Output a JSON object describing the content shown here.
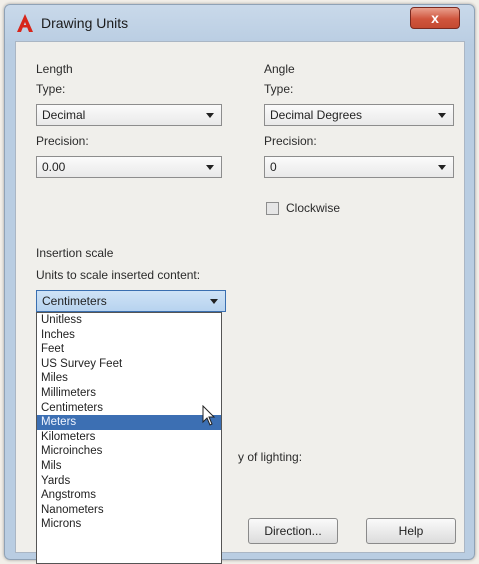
{
  "window": {
    "title": "Drawing Units",
    "close_label": "x"
  },
  "length": {
    "group_label": "Length",
    "type_label": "Type:",
    "type_value": "Decimal",
    "precision_label": "Precision:",
    "precision_value": "0.00"
  },
  "angle": {
    "group_label": "Angle",
    "type_label": "Type:",
    "type_value": "Decimal Degrees",
    "precision_label": "Precision:",
    "precision_value": "0",
    "clockwise_label": "Clockwise"
  },
  "insertion": {
    "group_label": "Insertion scale",
    "units_label": "Units to scale inserted content:",
    "selected_value": "Centimeters",
    "options": [
      "Unitless",
      "Inches",
      "Feet",
      "US Survey Feet",
      "Miles",
      "Millimeters",
      "Centimeters",
      "Meters",
      "Kilometers",
      "Microinches",
      "Mils",
      "Yards",
      "Angstroms",
      "Nanometers",
      "Microns"
    ],
    "highlighted_index": 7
  },
  "lighting_fragment": "y of lighting:",
  "buttons": {
    "direction": "Direction...",
    "help": "Help"
  },
  "colors": {
    "highlight": "#3c6fb3",
    "title_bar": "#c9d9ea",
    "close": "#d0553d"
  }
}
